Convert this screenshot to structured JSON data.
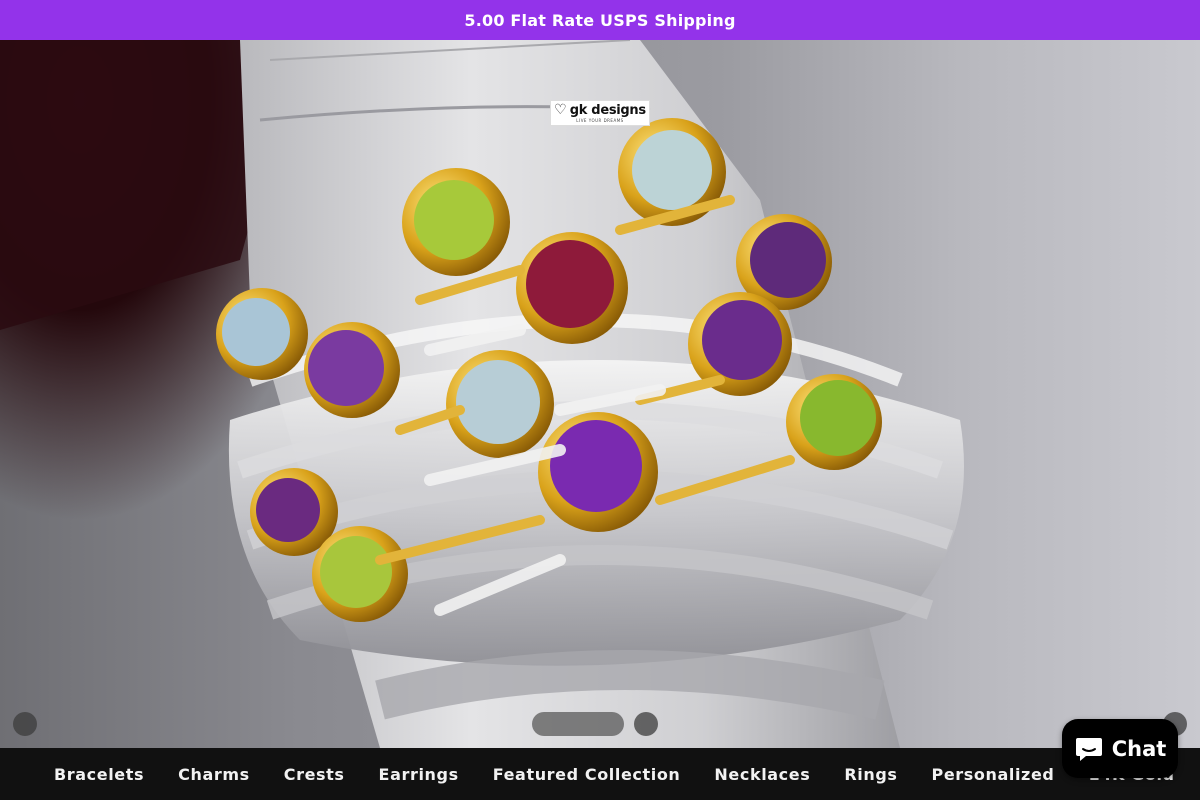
{
  "announcement": {
    "text": "5.00 Flat Rate USPS Shipping"
  },
  "logo": {
    "name": "gk designs",
    "tagline": "LIVE YOUR DREAMS",
    "icon": "heart-logo-icon"
  },
  "hero": {
    "image_subject": "stacked-gemstone-rings-image"
  },
  "nav": {
    "items": [
      {
        "label": "Bracelets"
      },
      {
        "label": "Charms"
      },
      {
        "label": "Crests"
      },
      {
        "label": "Earrings"
      },
      {
        "label": "Featured Collection"
      },
      {
        "label": "Necklaces"
      },
      {
        "label": "Rings"
      },
      {
        "label": "Personalized"
      },
      {
        "label": "14K Gold"
      }
    ]
  },
  "chat": {
    "label": "Chat",
    "icon": "chat-bubble-icon"
  },
  "colors": {
    "announcement_bg": "#9333ea",
    "nav_bg": "#111111",
    "chat_bg": "#000000"
  }
}
